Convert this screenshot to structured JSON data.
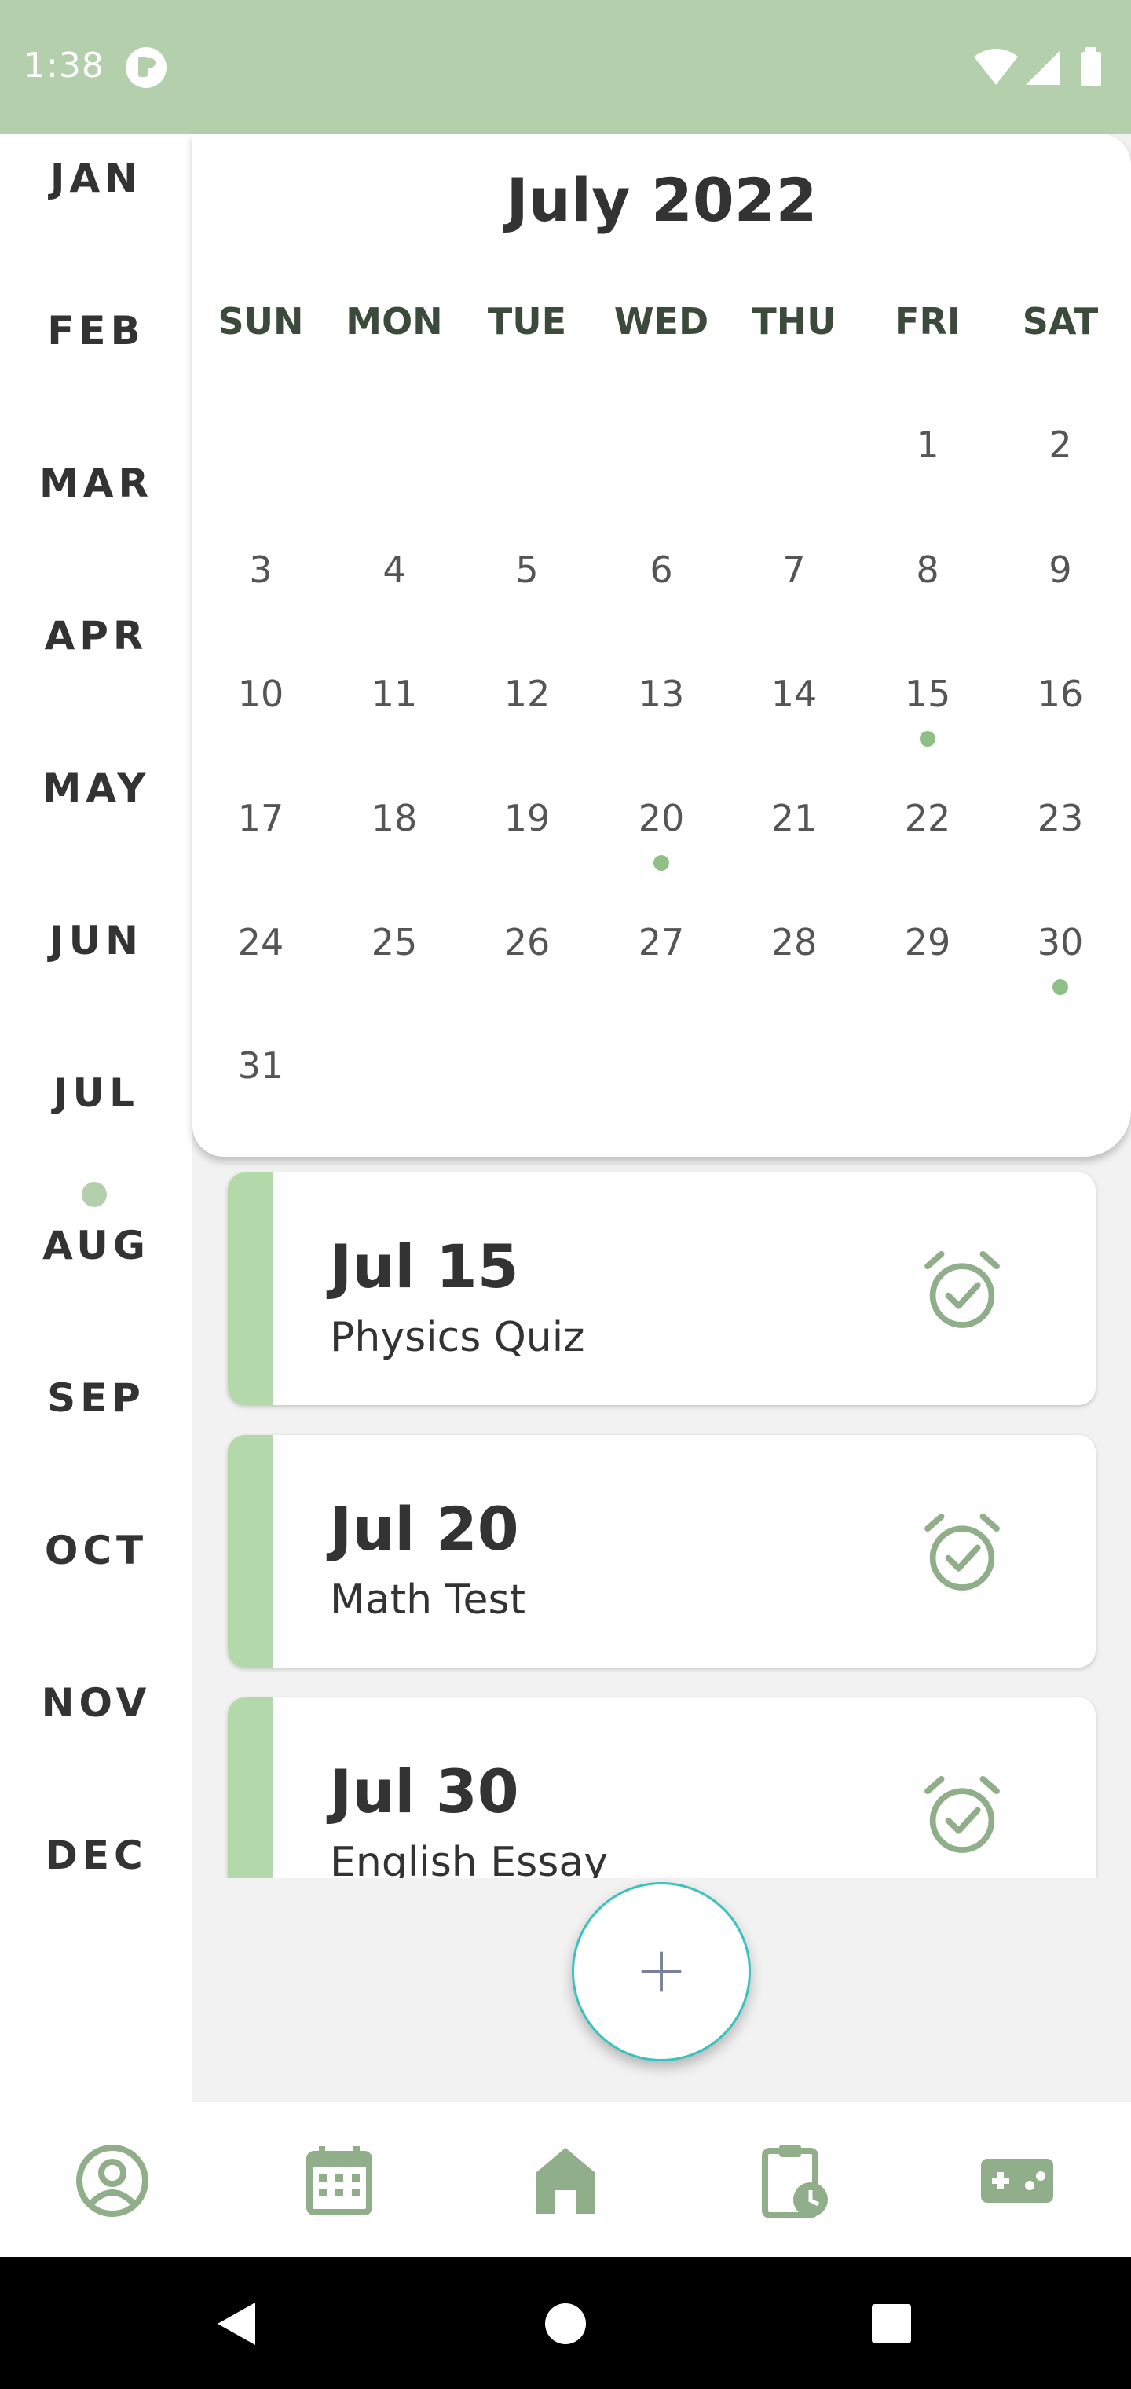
{
  "status_bar": {
    "time": "1:38",
    "color": "#b3cfab"
  },
  "months": [
    "JAN",
    "FEB",
    "MAR",
    "APR",
    "MAY",
    "JUN",
    "JUL",
    "AUG",
    "SEP",
    "OCT",
    "NOV",
    "DEC"
  ],
  "selected_month": "JUL",
  "calendar": {
    "title": "July 2022",
    "weekdays": [
      "SUN",
      "MON",
      "TUE",
      "WED",
      "THU",
      "FRI",
      "SAT"
    ],
    "days": [
      "1",
      "2",
      "3",
      "4",
      "5",
      "6",
      "7",
      "8",
      "9",
      "10",
      "11",
      "12",
      "13",
      "14",
      "15",
      "16",
      "17",
      "18",
      "19",
      "20",
      "21",
      "22",
      "23",
      "24",
      "25",
      "26",
      "27",
      "28",
      "29",
      "30",
      "31"
    ],
    "days_with_events": [
      "15",
      "20",
      "30"
    ]
  },
  "events": [
    {
      "date": "Jul 15",
      "name": "Physics Quiz"
    },
    {
      "date": "Jul 20",
      "name": "Math Test"
    },
    {
      "date": "Jul 30",
      "name": "English Essay"
    }
  ],
  "fab": {
    "icon": "plus-icon"
  },
  "bottom_nav": [
    {
      "icon": "profile-icon"
    },
    {
      "icon": "calendar-icon"
    },
    {
      "icon": "home-icon"
    },
    {
      "icon": "clipboard-clock-icon"
    },
    {
      "icon": "gamepad-icon"
    }
  ],
  "colors": {
    "accent_green": "#b3cfab",
    "icon_green": "#8fae89",
    "fab_border": "#39c3bd"
  }
}
